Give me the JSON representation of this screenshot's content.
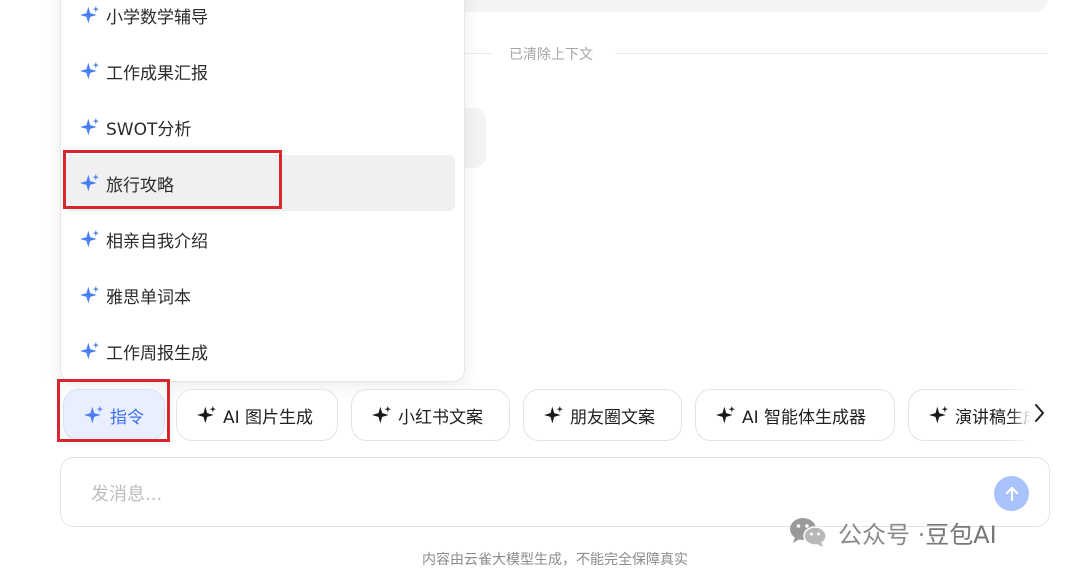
{
  "divider": {
    "text": "已清除上下文"
  },
  "command_menu": {
    "items": [
      {
        "label": "小学数学辅导"
      },
      {
        "label": "工作成果汇报"
      },
      {
        "label": "SWOT分析"
      },
      {
        "label": "旅行攻略"
      },
      {
        "label": "相亲自我介绍"
      },
      {
        "label": "雅思单词本"
      },
      {
        "label": "工作周报生成"
      }
    ],
    "hovered_item": "旅行攻略"
  },
  "chips": [
    {
      "label": "指令"
    },
    {
      "label": "AI 图片生成"
    },
    {
      "label": "小红书文案"
    },
    {
      "label": "朋友圈文案"
    },
    {
      "label": "AI 智能体生成器"
    },
    {
      "label": "演讲稿生成"
    }
  ],
  "composer": {
    "placeholder": "发消息..."
  },
  "watermark": {
    "prefix": "公众号 · ",
    "name": "豆包AI"
  },
  "footer": {
    "disclaimer": "内容由云雀大模型生成，不能完全保障真实"
  },
  "colors": {
    "accent_blue": "#3b6ef0",
    "spark_blue": "#4a7cf6",
    "annotation_red": "#d7262d",
    "send_button": "#a9c2fb"
  },
  "icons": {
    "spark": "sparkle-icon",
    "send": "arrow-up-icon",
    "scroll": "chevron-right-icon",
    "watermark_logo": "wechat-icon"
  }
}
